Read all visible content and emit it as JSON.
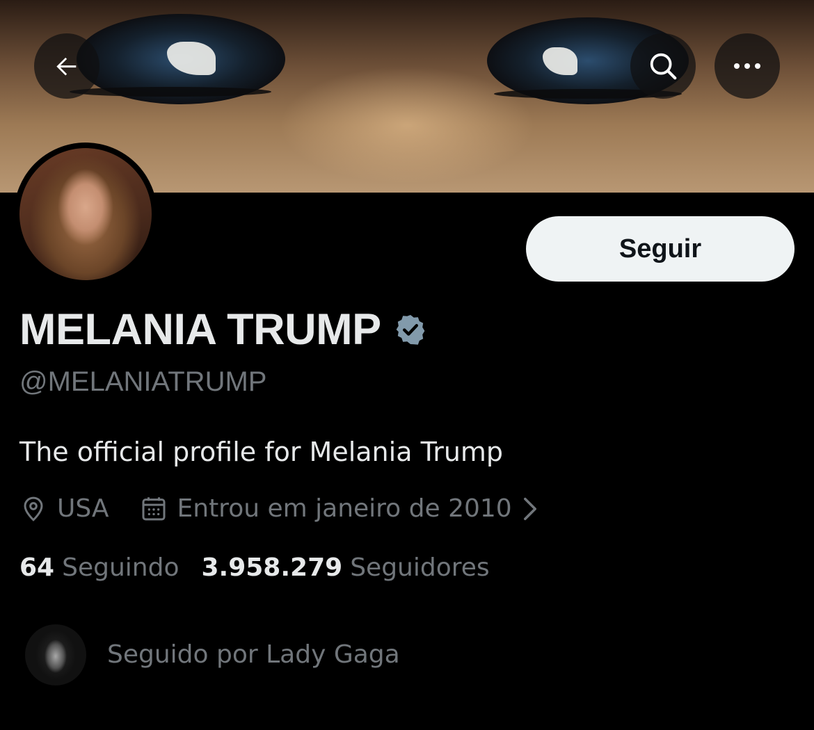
{
  "header": {
    "back_icon": "arrow-left-icon",
    "search_icon": "search-icon",
    "more_icon": "more-horizontal-icon"
  },
  "profile": {
    "display_name": "MELANIA TRUMP",
    "verified": true,
    "verified_color": "#829aab",
    "handle": "@MELANIATRUMP",
    "bio": "The official profile for Melania Trump",
    "location": "USA",
    "location_icon": "location-pin-icon",
    "joined": "Entrou em janeiro de 2010",
    "joined_icon": "calendar-icon",
    "follow_label": "Seguir"
  },
  "stats": {
    "following_count": "64",
    "following_label": "Seguindo",
    "followers_count": "3.958.279",
    "followers_label": "Seguidores"
  },
  "followed_by": {
    "text": "Seguido por Lady Gaga"
  },
  "colors": {
    "background": "#000000",
    "primary_text": "#e7e9ea",
    "secondary_text": "#71767b",
    "follow_button_bg": "#eff3f4"
  }
}
